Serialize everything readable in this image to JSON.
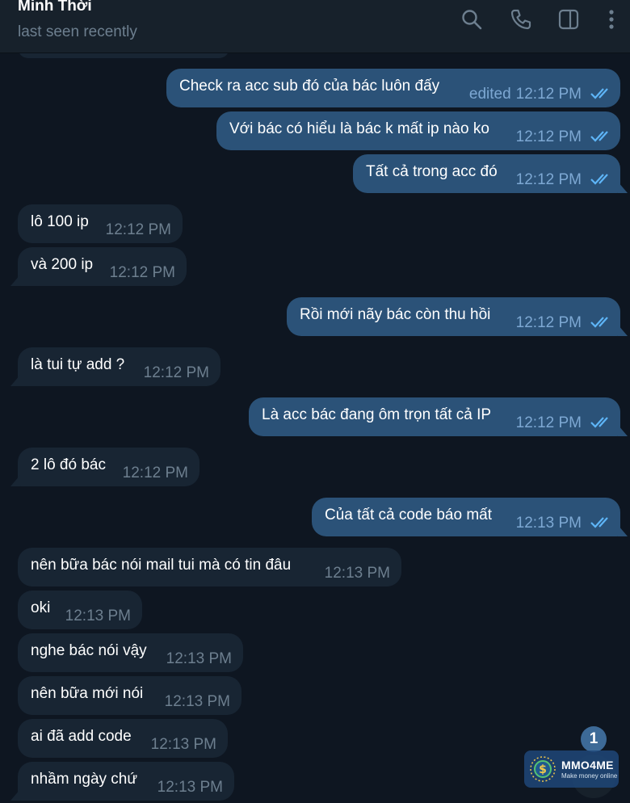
{
  "header": {
    "contact_name": "Minh Thời",
    "status": "last seen recently",
    "icons": [
      "search-icon",
      "phone-icon",
      "sidebar-toggle-icon",
      "more-vert-icon"
    ]
  },
  "messages": [
    {
      "dir": "out",
      "text": "Check ra acc sub đó của bác luôn đấy",
      "edited": "edited",
      "time": "12:12 PM",
      "read": true
    },
    {
      "dir": "out",
      "text": "Với bác có hiểu là bác k mất ip nào ko",
      "time": "12:12 PM",
      "read": true
    },
    {
      "dir": "out",
      "text": "Tất cả trong acc đó",
      "time": "12:12 PM",
      "read": true
    },
    {
      "dir": "in",
      "text": "lô 100 ip",
      "time": "12:12 PM"
    },
    {
      "dir": "in",
      "text": "và 200 ip",
      "time": "12:12 PM"
    },
    {
      "dir": "out",
      "text": "Rồi mới nãy bác còn thu hồi",
      "time": "12:12 PM",
      "read": true
    },
    {
      "dir": "in",
      "text": "là tui tự add ?",
      "time": "12:12 PM"
    },
    {
      "dir": "out",
      "text": "Là acc bác đang ôm trọn tất cả IP",
      "time": "12:12 PM",
      "read": true
    },
    {
      "dir": "in",
      "text": "2 lô đó bác",
      "time": "12:12 PM"
    },
    {
      "dir": "out",
      "text": "Của tất cả code báo mất",
      "time": "12:13 PM",
      "read": true
    },
    {
      "dir": "in",
      "text": "nên bữa bác nói mail tui mà có tin đâu",
      "time": "12:13 PM"
    },
    {
      "dir": "in",
      "text": "oki",
      "time": "12:13 PM"
    },
    {
      "dir": "in",
      "text": "nghe bác nói vậy",
      "time": "12:13 PM"
    },
    {
      "dir": "in",
      "text": "nên bữa mới nói",
      "time": "12:13 PM"
    },
    {
      "dir": "in",
      "text": "ai đã add code",
      "time": "12:13 PM"
    },
    {
      "dir": "in",
      "text": "nhầm ngày chứ",
      "time": "12:13 PM"
    }
  ],
  "unread_count": "1",
  "watermark": {
    "title": "MMO4ME",
    "subtitle": "Make money online"
  },
  "colors": {
    "background": "#0e1621",
    "header": "#17212b",
    "incoming_bubble": "#182533",
    "outgoing_bubble": "#2b5278",
    "read_check": "#5eb5f7",
    "muted_text": "#6d7f8f"
  }
}
